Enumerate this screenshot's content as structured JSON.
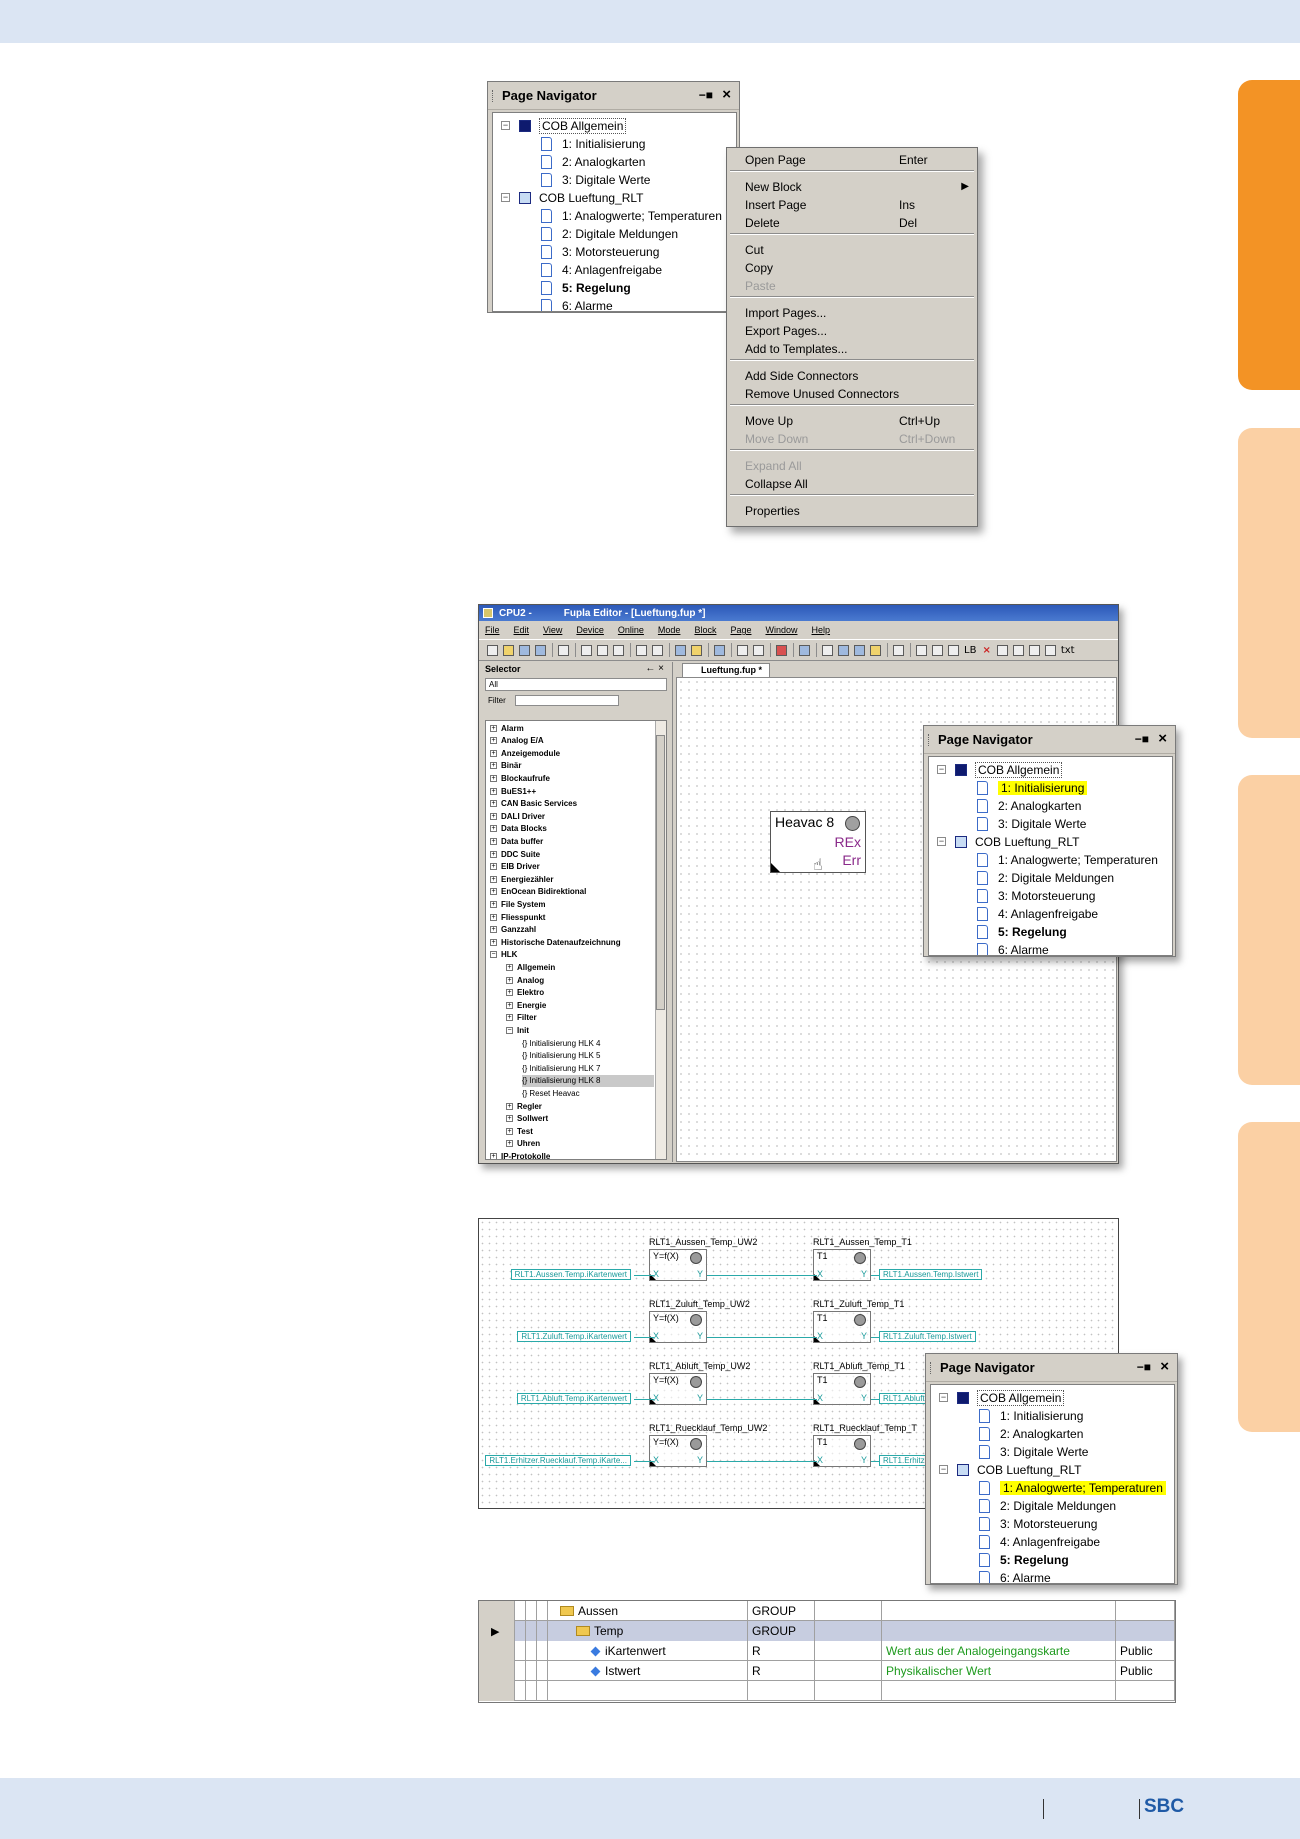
{
  "page_navigator": {
    "title": "Page Navigator",
    "groups": [
      {
        "name": "COB Allgemein",
        "icon": "cob-dark-icon",
        "pages": [
          "1: Initialisierung",
          "2: Analogkarten",
          "3: Digitale Werte"
        ]
      },
      {
        "name": "COB Lueftung_RLT",
        "icon": "cob-light-icon",
        "pages": [
          "1: Analogwerte; Temperaturen",
          "2: Digitale Meldungen",
          "3: Motorsteuerung",
          "4: Anlagenfreigabe",
          "5: Regelung",
          "6: Alarme"
        ]
      }
    ],
    "bold_page": "5: Regelung"
  },
  "context_menu": {
    "items": [
      {
        "label": "Open Page",
        "shortcut": "Enter"
      },
      {
        "label": "New Block",
        "shortcut": "",
        "submenu": true
      },
      {
        "label": "Insert Page",
        "shortcut": "Ins"
      },
      {
        "label": "Delete",
        "shortcut": "Del"
      },
      {
        "label": "Cut",
        "shortcut": ""
      },
      {
        "label": "Copy",
        "shortcut": ""
      },
      {
        "label": "Paste",
        "shortcut": "",
        "disabled": true
      },
      {
        "label": "Import Pages...",
        "shortcut": ""
      },
      {
        "label": "Export Pages...",
        "shortcut": ""
      },
      {
        "label": "Add to Templates...",
        "shortcut": ""
      },
      {
        "label": "Add Side Connectors",
        "shortcut": ""
      },
      {
        "label": "Remove Unused Connectors",
        "shortcut": ""
      },
      {
        "label": "Move Up",
        "shortcut": "Ctrl+Up"
      },
      {
        "label": "Move Down",
        "shortcut": "Ctrl+Down",
        "disabled": true
      },
      {
        "label": "Expand All",
        "shortcut": "",
        "disabled": true
      },
      {
        "label": "Collapse All",
        "shortcut": ""
      },
      {
        "label": "Properties",
        "shortcut": ""
      }
    ]
  },
  "editor": {
    "title_cpu": "CPU2 -",
    "title": "Fupla Editor - [Lueftung.fup *]",
    "menu": [
      "File",
      "Edit",
      "View",
      "Device",
      "Online",
      "Mode",
      "Block",
      "Page",
      "Window",
      "Help"
    ],
    "toolbar_text": [
      "LB",
      "txt"
    ],
    "selector": {
      "title": "Selector",
      "pin": "← ×",
      "all_value": "All",
      "filter_label": "Filter",
      "items": [
        {
          "label": "Alarm",
          "level": 0,
          "exp": "+"
        },
        {
          "label": "Analog E/A",
          "level": 0,
          "exp": "+"
        },
        {
          "label": "Anzeigemodule",
          "level": 0,
          "exp": "+"
        },
        {
          "label": "Binär",
          "level": 0,
          "exp": "+"
        },
        {
          "label": "Blockaufrufe",
          "level": 0,
          "exp": "+"
        },
        {
          "label": "BuES1++",
          "level": 0,
          "exp": "+"
        },
        {
          "label": "CAN Basic Services",
          "level": 0,
          "exp": "+"
        },
        {
          "label": "DALI Driver",
          "level": 0,
          "exp": "+"
        },
        {
          "label": "Data Blocks",
          "level": 0,
          "exp": "+"
        },
        {
          "label": "Data buffer",
          "level": 0,
          "exp": "+"
        },
        {
          "label": "DDC Suite",
          "level": 0,
          "exp": "+"
        },
        {
          "label": "EIB Driver",
          "level": 0,
          "exp": "+"
        },
        {
          "label": "Energiezähler",
          "level": 0,
          "exp": "+"
        },
        {
          "label": "EnOcean Bidirektional",
          "level": 0,
          "exp": "+"
        },
        {
          "label": "File System",
          "level": 0,
          "exp": "+"
        },
        {
          "label": "Fliesspunkt",
          "level": 0,
          "exp": "+"
        },
        {
          "label": "Ganzzahl",
          "level": 0,
          "exp": "+"
        },
        {
          "label": "Historische Datenaufzeichnung",
          "level": 0,
          "exp": "+"
        },
        {
          "label": "HLK",
          "level": 0,
          "exp": "-"
        },
        {
          "label": "Allgemein",
          "level": 1,
          "exp": "+"
        },
        {
          "label": "Analog",
          "level": 1,
          "exp": "+"
        },
        {
          "label": "Elektro",
          "level": 1,
          "exp": "+"
        },
        {
          "label": "Energie",
          "level": 1,
          "exp": "+"
        },
        {
          "label": "Filter",
          "level": 1,
          "exp": "+"
        },
        {
          "label": "Init",
          "level": 1,
          "exp": "-"
        },
        {
          "label": "Initialisierung HLK 4",
          "level": 2,
          "exp": ""
        },
        {
          "label": "Initialisierung HLK 5",
          "level": 2,
          "exp": ""
        },
        {
          "label": "Initialisierung HLK 7",
          "level": 2,
          "exp": ""
        },
        {
          "label": "Initialisierung HLK 8",
          "level": 2,
          "exp": "",
          "selected": true
        },
        {
          "label": "Reset Heavac",
          "level": 2,
          "exp": ""
        },
        {
          "label": "Regler",
          "level": 1,
          "exp": "+"
        },
        {
          "label": "Sollwert",
          "level": 1,
          "exp": "+"
        },
        {
          "label": "Test",
          "level": 1,
          "exp": "+"
        },
        {
          "label": "Uhren",
          "level": 1,
          "exp": "+"
        },
        {
          "label": "IP-Protokolle",
          "level": 0,
          "exp": "+"
        }
      ]
    },
    "tab": "Lueftung.fup *",
    "block": {
      "name": "Heavac 8",
      "out1": "REx",
      "out2": "Err"
    }
  },
  "nav_highlight_1": "1: Initialisierung",
  "nav_highlight_2": "1: Analogwerte; Temperaturen",
  "wiring": {
    "rows": [
      {
        "label_in": "RLT1.Aussen.Temp.iKartenwert",
        "b1": "RLT1_Aussen_Temp_UW2",
        "b2": "RLT1_Aussen_Temp_T1",
        "label_out": "RLT1.Aussen.Temp.Istwert"
      },
      {
        "label_in": "RLT1.Zuluft.Temp.iKartenwert",
        "b1": "RLT1_Zuluft_Temp_UW2",
        "b2": "RLT1_Zuluft_Temp_T1",
        "label_out": "RLT1.Zuluft.Temp.Istwert"
      },
      {
        "label_in": "RLT1.Abluft.Temp.iKartenwert",
        "b1": "RLT1_Abluft_Temp_UW2",
        "b2": "RLT1_Abluft_Temp_T1",
        "label_out": "RLT1.Abluft"
      },
      {
        "label_in": "RLT1.Erhitzer.Ruecklauf.Temp.iKarte...",
        "b1": "RLT1_Ruecklauf_Temp_UW2",
        "b2": "RLT1_Ruecklauf_Temp_T",
        "label_out": "RLT1.Erhitz"
      }
    ],
    "fx": "Y=f(X)",
    "t1": "T1",
    "x": "X",
    "y": "Y"
  },
  "grid": {
    "rows": [
      {
        "name": "Aussen",
        "type": "GROUP",
        "comment": "",
        "access": "",
        "icon": "folder-icon",
        "indent": 1
      },
      {
        "name": "Temp",
        "type": "GROUP",
        "comment": "",
        "access": "",
        "icon": "folder-icon",
        "indent": 2,
        "selected": true
      },
      {
        "name": "iKartenwert",
        "type": "R",
        "comment": "Wert aus der Analogeingangskarte",
        "access": "Public",
        "icon": "variable-icon",
        "indent": 3
      },
      {
        "name": "Istwert",
        "type": "R",
        "comment": "Physikalischer Wert",
        "access": "Public",
        "icon": "variable-icon",
        "indent": 3
      }
    ]
  },
  "footer": {
    "brand": "SBC"
  },
  "colors": {
    "band": "#dbe5f3",
    "tab_orange": "#f39325",
    "tab_light": "#fbd0a4",
    "highlight": "#ffff00",
    "brand": "#1f5aa6"
  }
}
